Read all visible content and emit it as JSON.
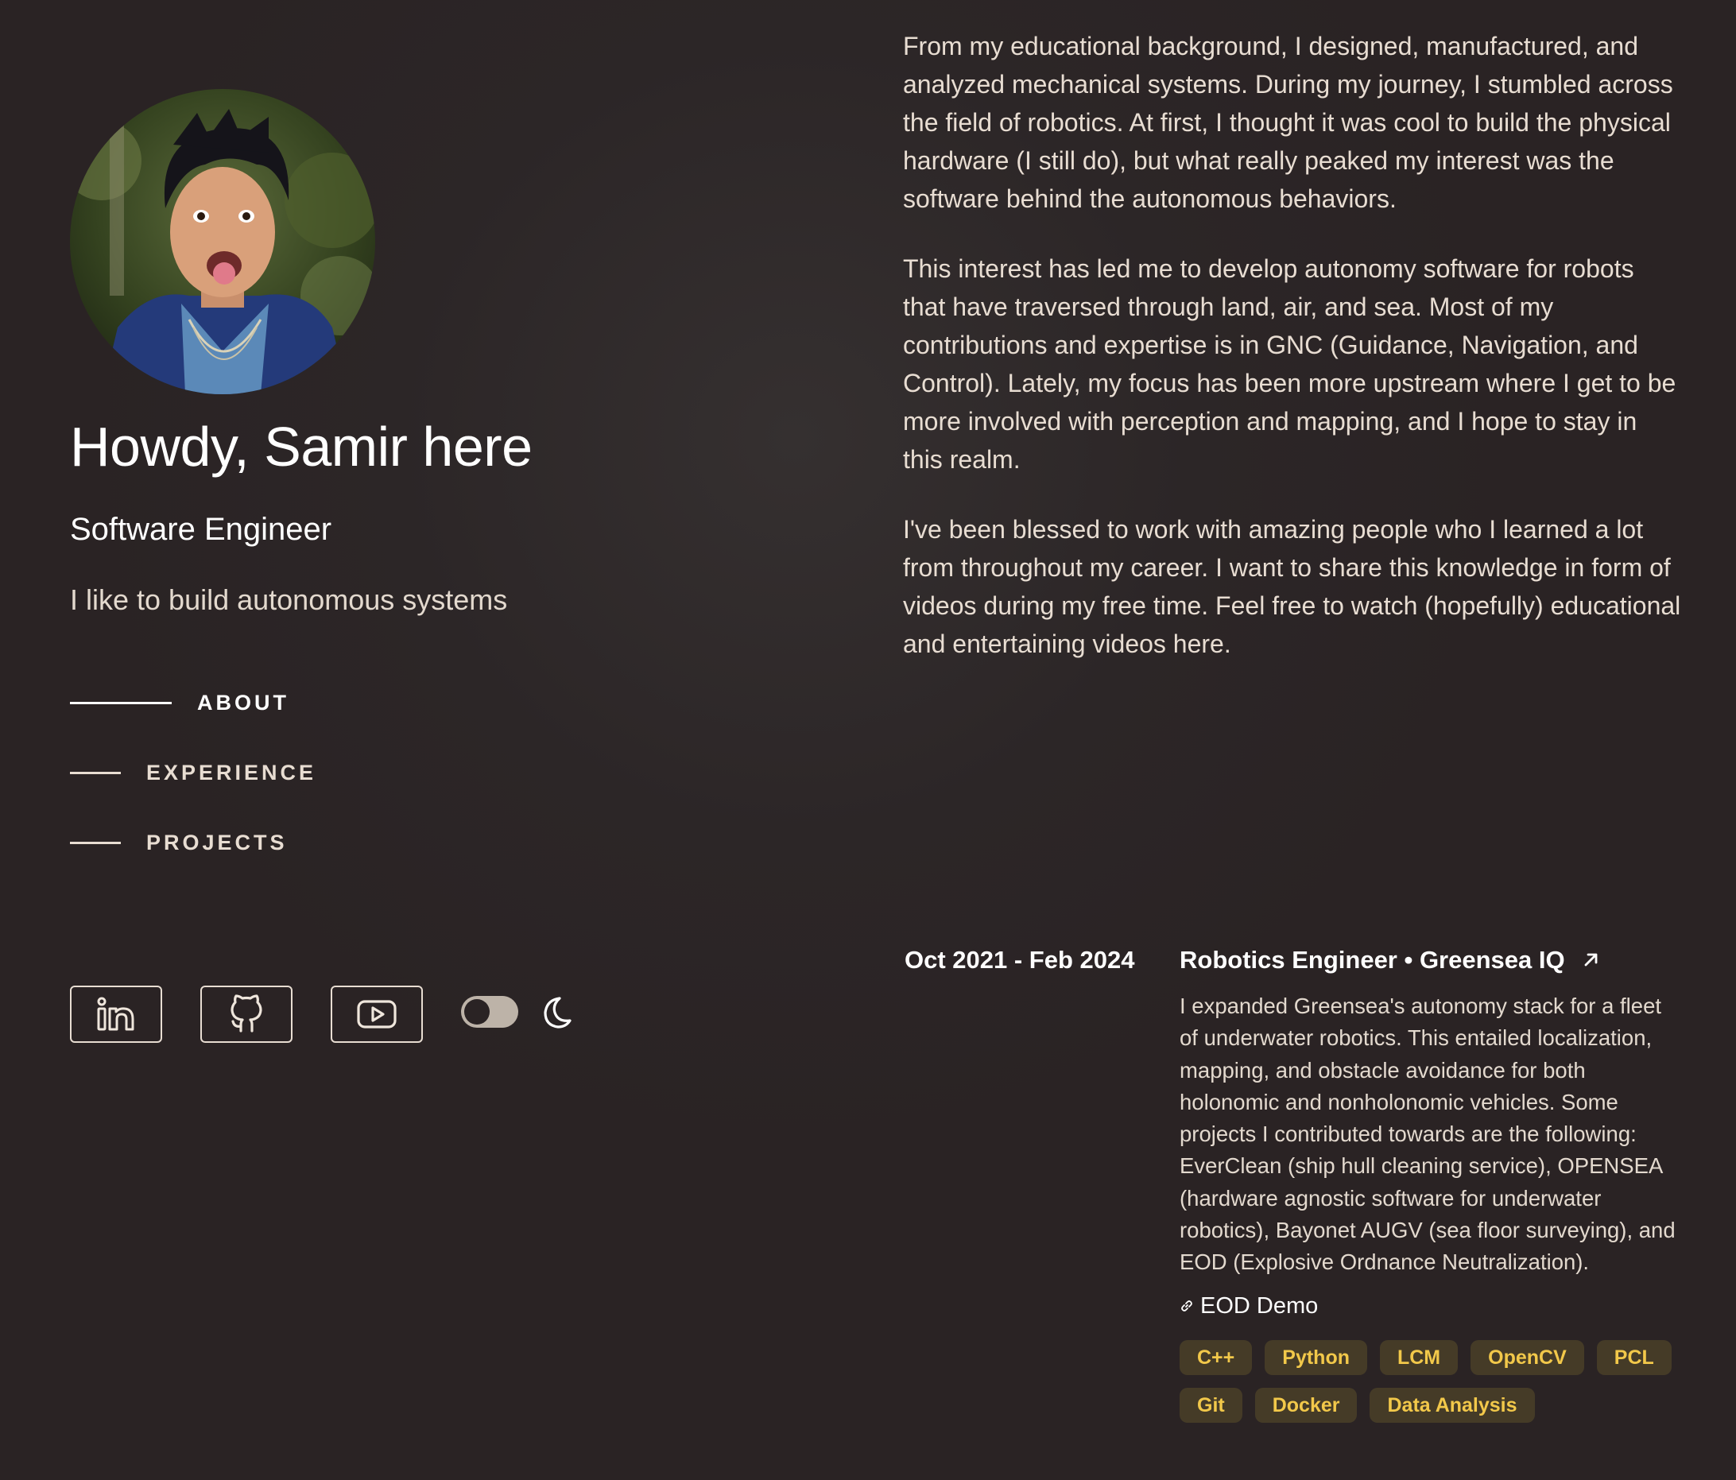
{
  "profile": {
    "name": "Howdy, Samir here",
    "role": "Software Engineer",
    "tagline": "I like to build autonomous systems"
  },
  "nav": {
    "items": [
      {
        "label": "ABOUT",
        "active": true
      },
      {
        "label": "EXPERIENCE",
        "active": false
      },
      {
        "label": "PROJECTS",
        "active": false
      }
    ]
  },
  "socials": {
    "items": [
      "linkedin-icon",
      "github-icon",
      "youtube-icon"
    ],
    "theme_toggle": "toggle-switch",
    "theme_icon": "moon-icon"
  },
  "about": {
    "paragraphs": [
      "From my educational background, I designed, manufactured, and analyzed mechanical systems. During my journey, I stumbled across the field of robotics. At first, I thought it was cool to build the physical hardware (I still do), but what really peaked my interest was the software behind the autonomous behaviors.",
      "This interest has led me to develop autonomy software for robots that have traversed through land, air, and sea. Most of my contributions and expertise is in GNC (Guidance, Navigation, and Control). Lately, my focus has been more upstream where I get to be more involved with perception and mapping, and I hope to stay in this realm.",
      "I've been blessed to work with amazing people who I learned a lot from throughout my career. I want to share this knowledge in form of videos during my free time. Feel free to watch (hopefully) educational and entertaining videos here."
    ]
  },
  "experience": {
    "date": "Oct 2021 - Feb 2024",
    "title": "Robotics Engineer • Greensea IQ",
    "description": "I expanded Greensea's autonomy stack for a fleet of underwater robotics. This entailed localization, mapping, and obstacle avoidance for both holonomic and nonholonomic vehicles. Some projects I contributed towards are the following: EverClean (ship hull cleaning service), OPENSEA (hardware agnostic software for underwater robotics), Bayonet AUGV (sea floor surveying), and EOD (Explosive Ordnance Neutralization).",
    "link_label": "EOD Demo",
    "tags": [
      "C++",
      "Python",
      "LCM",
      "OpenCV",
      "PCL",
      "Git",
      "Docker",
      "Data Analysis"
    ]
  },
  "colors": {
    "background": "#2a2324",
    "text": "#efe6dc",
    "tag_bg": "#453b27",
    "tag_text": "#f2c84a"
  }
}
